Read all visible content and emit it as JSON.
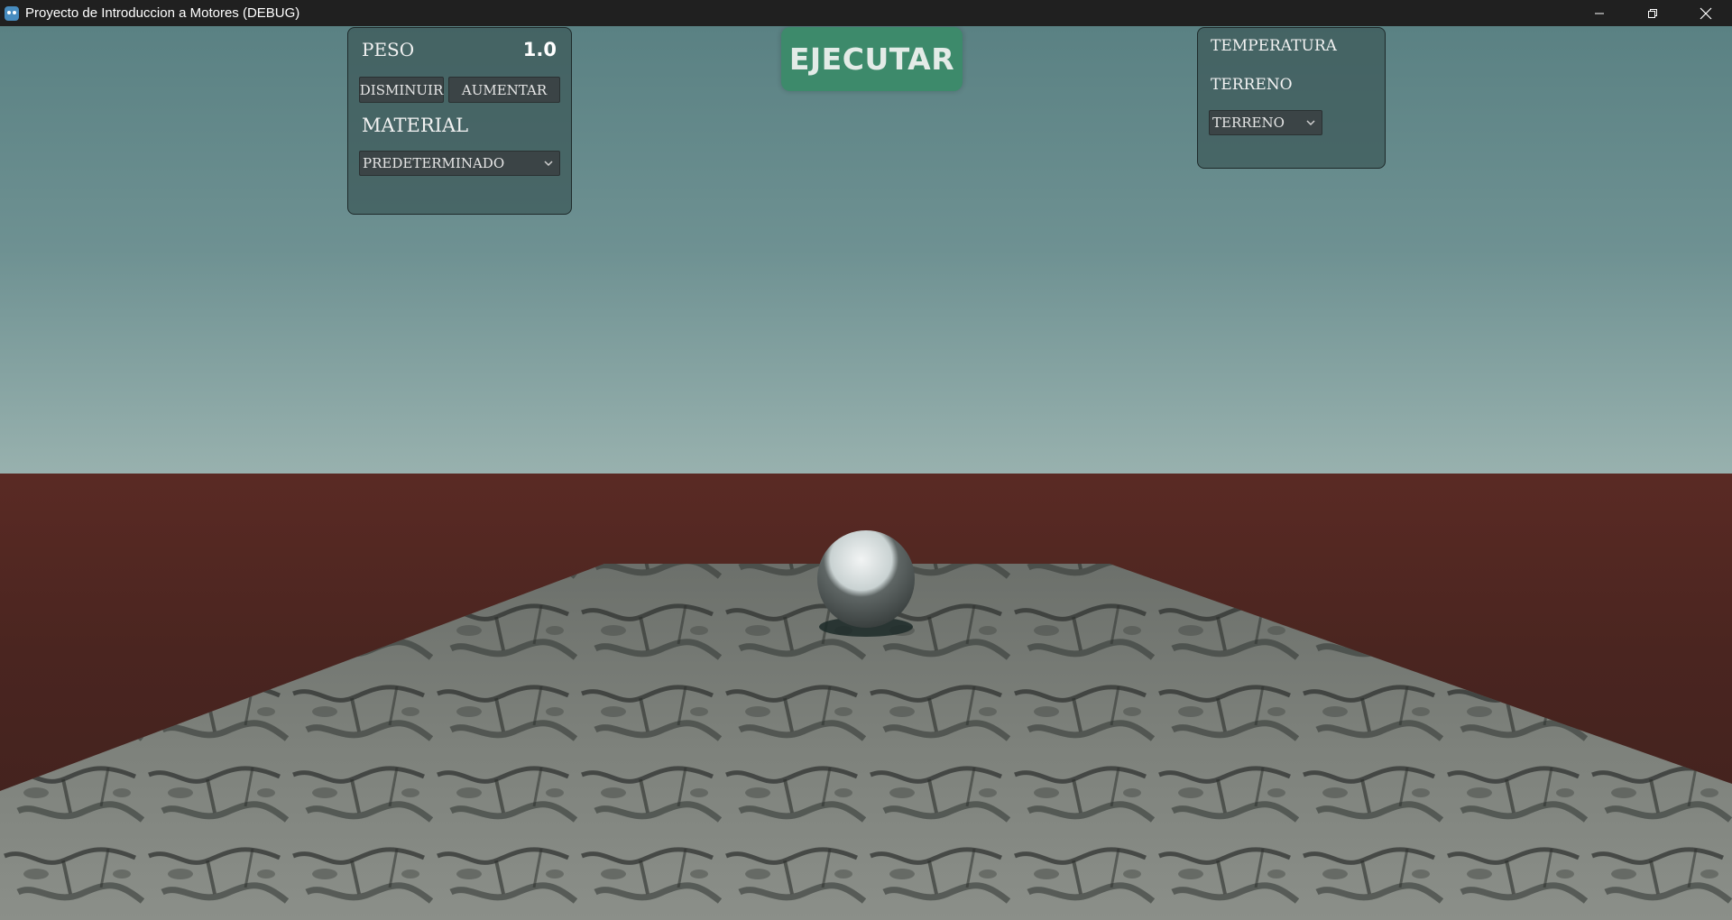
{
  "window": {
    "title": "Proyecto de Introduccion a Motores (DEBUG)",
    "controls": {
      "minimize_icon": "minimize-icon",
      "restore_icon": "restore-icon",
      "close_icon": "close-icon"
    }
  },
  "left_panel": {
    "peso_label": "PESO",
    "peso_value": "1.0",
    "decrease_label": "DISMINUIR",
    "increase_label": "AUMENTAR",
    "material_label": "MATERIAL",
    "material_selected": "PREDETERMINADO"
  },
  "run_button": {
    "label": "EJECUTAR"
  },
  "right_panel": {
    "temperature_label": "TEMPERATURA",
    "terrain_label": "TERRENO",
    "terrain_selected": "TERRENO"
  },
  "colors": {
    "sky_top": "#5a8183",
    "sky_horizon": "#98b1ae",
    "ground": "#4a2520",
    "terrain": "#8a8f88",
    "run_button": "#3d8a6b",
    "panel": "#3e5a5a"
  }
}
